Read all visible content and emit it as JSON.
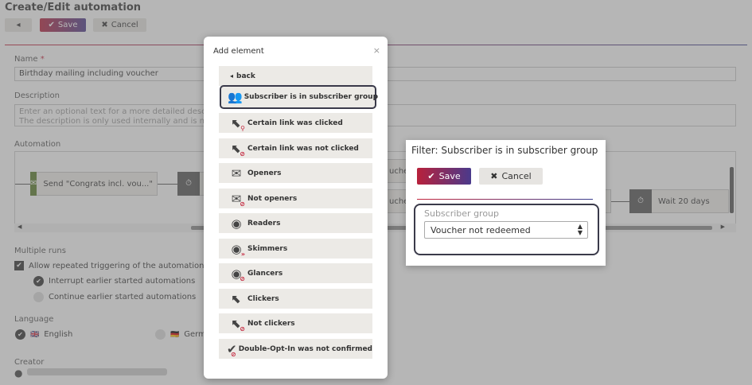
{
  "page": {
    "title": "Create/Edit automation",
    "save_label": "Save",
    "cancel_label": "Cancel",
    "name_label": "Name",
    "name_required_mark": "*",
    "name_value": "Birthday mailing including voucher",
    "description_label": "Description",
    "description_placeholder_line1": "Enter an optional text for a more detailed description",
    "description_placeholder_line2": "The description is only used internally and is not visi",
    "automation_label": "Automation",
    "node_send": "Send \"Congrats incl. vou...\"",
    "node_partial_1": "uche",
    "node_partial_2": "uche",
    "node_wait": "Wait 20 days",
    "multiple_runs_label": "Multiple runs",
    "allow_repeat": "Allow repeated triggering of the automation for e",
    "interrupt": "Interrupt earlier started automations",
    "continue": "Continue earlier started automations",
    "language_label": "Language",
    "lang_english": "English",
    "lang_german": "Germa",
    "creator_label": "Creator"
  },
  "modal": {
    "title": "Add element",
    "close": "×",
    "back": "back",
    "items": [
      {
        "label": "Subscriber is in subscriber group",
        "icon": "users-icon"
      },
      {
        "label": "Certain link was clicked",
        "icon": "cursor-link-icon"
      },
      {
        "label": "Certain link was not clicked",
        "icon": "cursor-link-not-icon"
      },
      {
        "label": "Openers",
        "icon": "envelope-open-icon"
      },
      {
        "label": "Not openers",
        "icon": "envelope-not-icon"
      },
      {
        "label": "Readers",
        "icon": "eye-icon"
      },
      {
        "label": "Skimmers",
        "icon": "eye-skim-icon"
      },
      {
        "label": "Glancers",
        "icon": "eye-glance-icon"
      },
      {
        "label": "Clickers",
        "icon": "cursor-icon"
      },
      {
        "label": "Not clickers",
        "icon": "cursor-not-icon"
      },
      {
        "label": "Double-Opt-In was not confirmed",
        "icon": "doi-not-icon"
      }
    ]
  },
  "filter": {
    "title": "Filter: Subscriber is in subscriber group",
    "save_label": "Save",
    "cancel_label": "Cancel",
    "group_label": "Subscriber group",
    "selected_value": "Voucher not redeemed"
  }
}
